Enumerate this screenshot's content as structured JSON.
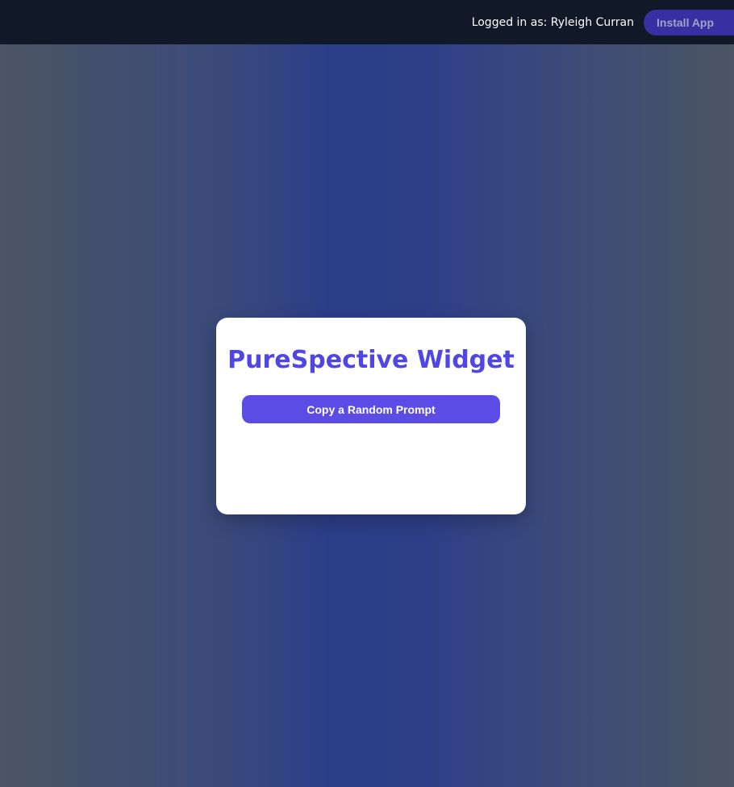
{
  "header": {
    "logged_in_text": "Logged in as: Ryleigh Curran",
    "install_label": "Install App"
  },
  "widget": {
    "title": "PureSpective Widget",
    "copy_button_label": "Copy a Random Prompt"
  },
  "colors": {
    "topbar_bg": "#111827",
    "accent": "#4f46e5",
    "button_bg": "#5b4ce6",
    "install_bg": "#3730a3"
  }
}
